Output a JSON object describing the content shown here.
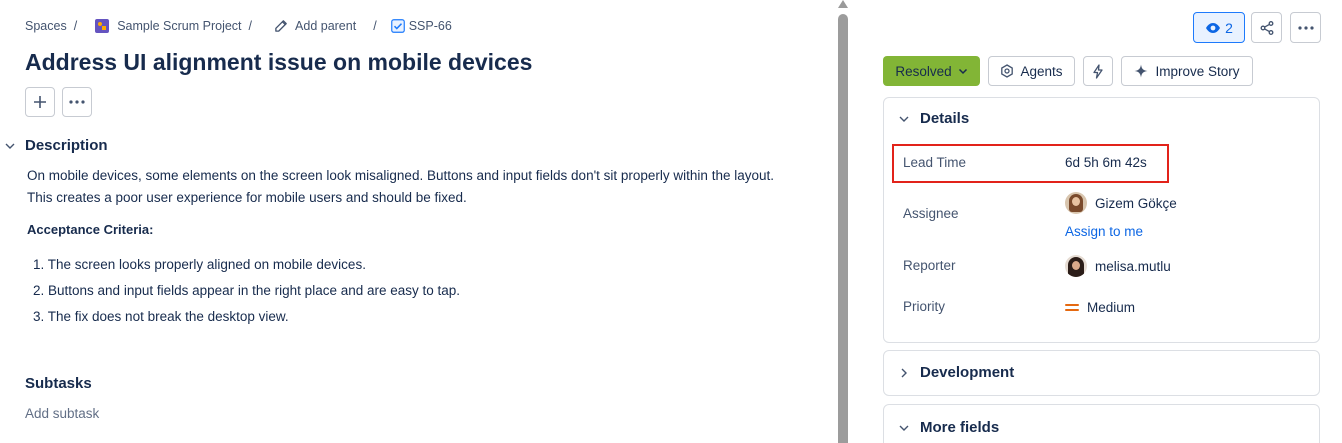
{
  "breadcrumb": {
    "spaces": "Spaces",
    "separator": "/",
    "project": "Sample Scrum Project",
    "add_parent": "Add parent",
    "issue_key": "SSP-66"
  },
  "issue": {
    "title": "Address UI alignment issue on mobile devices"
  },
  "description": {
    "heading": "Description",
    "paragraph_line1": "On mobile devices, some elements on the screen look misaligned. Buttons and input fields don't sit properly within the layout.",
    "paragraph_line2": "This creates a poor user experience for mobile users and should be fixed.",
    "acceptance_title": "Acceptance Criteria:",
    "criteria": [
      "1. The screen looks properly aligned on mobile devices.",
      "2. Buttons and input fields appear in the right place and are easy to tap.",
      "3. The fix does not break the desktop view."
    ]
  },
  "subtasks": {
    "heading": "Subtasks",
    "add_label": "Add subtask"
  },
  "toolbar": {
    "watch_count": "2",
    "status_label": "Resolved",
    "agents_label": "Agents",
    "improve_label": "Improve Story"
  },
  "details": {
    "heading": "Details",
    "lead_time_label": "Lead Time",
    "lead_time_value": "6d 5h 6m 42s",
    "assignee_label": "Assignee",
    "assignee_name": "Gizem Gökçe",
    "assign_to_me": "Assign to me",
    "reporter_label": "Reporter",
    "reporter_name": "melisa.mutlu",
    "priority_label": "Priority",
    "priority_value": "Medium"
  },
  "sections": {
    "development": "Development",
    "more_fields": "More fields"
  },
  "colors": {
    "status_green": "#82b536",
    "link_blue": "#0c66e4",
    "highlight_red": "#e2231a",
    "priority_orange": "#e56910"
  }
}
